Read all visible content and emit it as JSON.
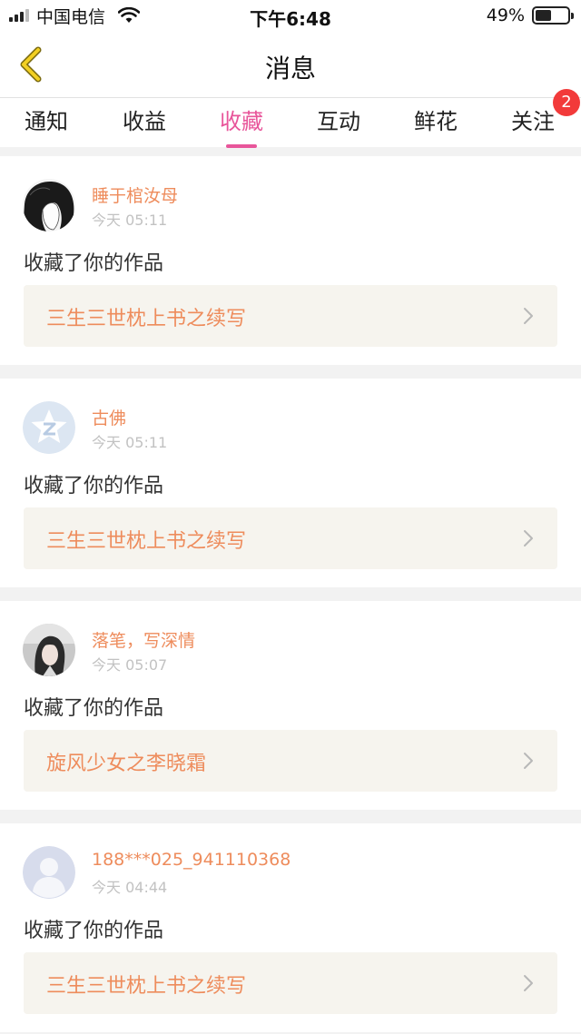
{
  "status_bar": {
    "carrier": "中国电信",
    "time": "下午6:48",
    "battery_percent": "49%",
    "battery_level": 0.49
  },
  "nav": {
    "back_icon": "chevron-left-icon",
    "title": "消息"
  },
  "tabs": [
    {
      "label": "通知",
      "active": false
    },
    {
      "label": "收益",
      "active": false
    },
    {
      "label": "收藏",
      "active": true
    },
    {
      "label": "互动",
      "active": false
    },
    {
      "label": "鲜花",
      "active": false
    },
    {
      "label": "关注",
      "active": false
    }
  ],
  "follow_badge": "2",
  "colors": {
    "accent": "#e8559a",
    "name_orange": "#ee8c5c",
    "badge_red": "#f23a3a",
    "link_bg": "#f6f4ee"
  },
  "messages": [
    {
      "user": "睡于棺汝母",
      "time": "今天 05:11",
      "action": "收藏了你的作品",
      "work": "三生三世枕上书之续写",
      "avatar": "sketch-avatar"
    },
    {
      "user": "古佛",
      "time": "今天 05:11",
      "action": "收藏了你的作品",
      "work": "三生三世枕上书之续写",
      "avatar": "qzone-star-avatar"
    },
    {
      "user": "落笔，写深情",
      "time": "今天 05:07",
      "action": "收藏了你的作品",
      "work": "旋风少女之李晓霜",
      "avatar": "photo-avatar"
    },
    {
      "user": "188***025_941110368",
      "time": "今天 04:44",
      "action": "收藏了你的作品",
      "work": "三生三世枕上书之续写",
      "avatar": "default-user-avatar"
    }
  ]
}
